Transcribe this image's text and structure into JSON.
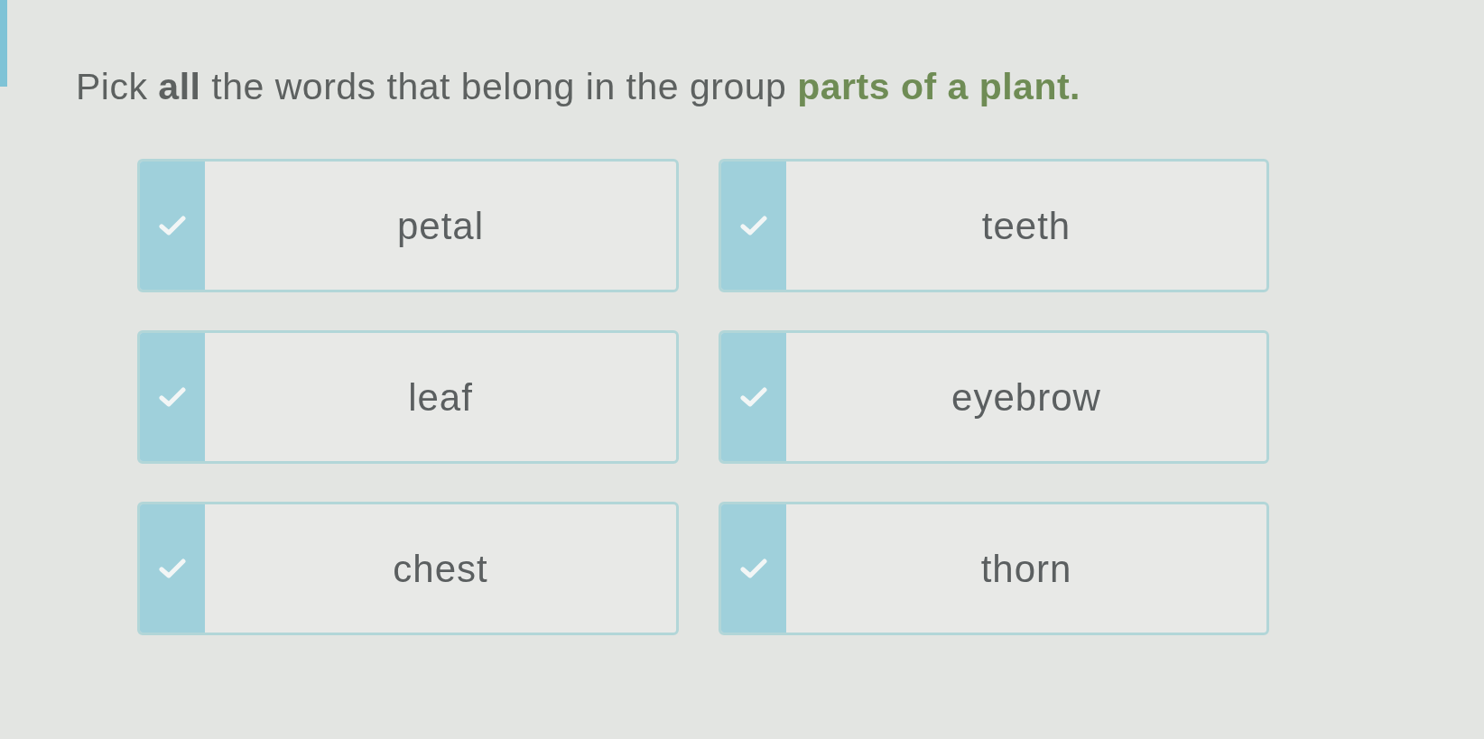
{
  "question": "Pick **all** the words that belong in the group **parts of a plant.**",
  "options": [
    {
      "label": "petal",
      "selected": false
    },
    {
      "label": "teeth",
      "selected": false
    },
    {
      "label": "leaf",
      "selected": false
    },
    {
      "label": "eyebrow",
      "selected": false
    },
    {
      "label": "chest",
      "selected": false
    },
    {
      "label": "thorn",
      "selected": false
    }
  ]
}
